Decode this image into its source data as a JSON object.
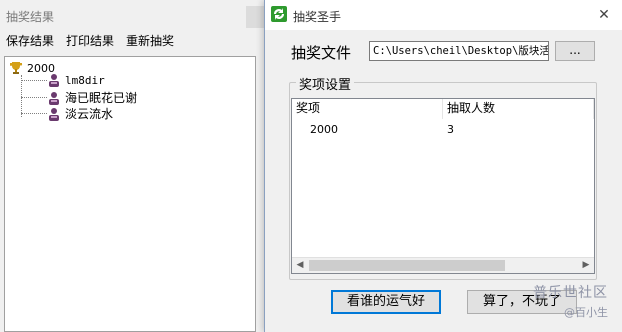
{
  "background_window": {
    "title": "抽奖结果",
    "menu": [
      "保存结果",
      "打印结果",
      "重新抽奖"
    ],
    "tree": {
      "root": "2000",
      "children": [
        "lm8dir",
        "海已眠花已谢",
        "淡云流水"
      ]
    }
  },
  "dialog": {
    "title": "抽奖圣手",
    "file_label": "抽奖文件",
    "file_path": "C:\\Users\\cheil\\Desktop\\版块活",
    "browse_label": "...",
    "group_title": "奖项设置",
    "columns": [
      "奖项",
      "抽取人数"
    ],
    "rows": [
      [
        "2000",
        "3"
      ]
    ],
    "lucky_button": "看谁的运气好",
    "quit_button": "算了，不玩了"
  },
  "watermark": {
    "main": "普乐世社区",
    "sub": "@百小生"
  },
  "colors": {
    "dialog_icon": "#2e9a2e",
    "trophy": "#d4a017",
    "person": "#6a3a6e"
  }
}
